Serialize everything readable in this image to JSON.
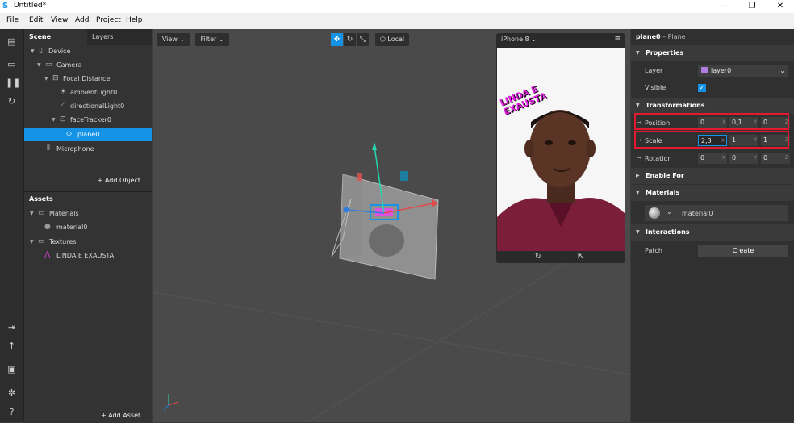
{
  "window": {
    "title": "Untitled*"
  },
  "menu": [
    "File",
    "Edit",
    "View",
    "Add",
    "Project",
    "Help"
  ],
  "scene": {
    "tabs": [
      "Scene",
      "Layers"
    ],
    "tree": [
      {
        "label": "Device",
        "depth": 0,
        "expand": "▼",
        "icon": "▯"
      },
      {
        "label": "Camera",
        "depth": 1,
        "expand": "▼",
        "icon": "▭"
      },
      {
        "label": "Focal Distance",
        "depth": 2,
        "expand": "▼",
        "icon": "⊟"
      },
      {
        "label": "ambientLight0",
        "depth": 3,
        "expand": "",
        "icon": "☀"
      },
      {
        "label": "directionalLight0",
        "depth": 3,
        "expand": "",
        "icon": "⟋"
      },
      {
        "label": "faceTracker0",
        "depth": 3,
        "expand": "▼",
        "icon": "⊡"
      },
      {
        "label": "plane0",
        "depth": 4,
        "expand": "",
        "icon": "◇",
        "selected": true
      },
      {
        "label": "Microphone",
        "depth": 1,
        "expand": "",
        "icon": "⦀"
      }
    ],
    "add_object": "Add Object"
  },
  "assets": {
    "title": "Assets",
    "items": [
      {
        "label": "Materials",
        "depth": 0,
        "expand": "▼",
        "icon": "▭"
      },
      {
        "label": "material0",
        "depth": 1,
        "expand": "",
        "icon": "●"
      },
      {
        "label": "Textures",
        "depth": 0,
        "expand": "▼",
        "icon": "▭"
      },
      {
        "label": "LINDA E EXAUSTA",
        "depth": 1,
        "expand": "",
        "icon": "⋀"
      }
    ],
    "add_asset": "Add Asset"
  },
  "viewport": {
    "view_label": "View",
    "filter_label": "Filter",
    "local_label": "Local",
    "sticker_text": "LINDA E EXAUSTA"
  },
  "simulator": {
    "device": "iPhone 8",
    "sticker_line1": "LINDA E",
    "sticker_line2": "EXAUSTA"
  },
  "properties": {
    "object_name": "plane0",
    "object_type": "– Plane",
    "sections": {
      "properties": "Properties",
      "transformations": "Transformations",
      "enable_for": "Enable For",
      "materials": "Materials",
      "interactions": "Interactions"
    },
    "layer_label": "Layer",
    "layer_value": "layer0",
    "layer_color": "#b07ee0",
    "visible_label": "Visible",
    "position_label": "Position",
    "position": {
      "x": "0",
      "y": "0,1",
      "z": "0"
    },
    "scale_label": "Scale",
    "scale": {
      "x": "2,3",
      "y": "1",
      "z": "1"
    },
    "rotation_label": "Rotation",
    "rotation": {
      "x": "0",
      "y": "0",
      "z": "0"
    },
    "material_value": "material0",
    "patch_label": "Patch",
    "create_label": "Create",
    "axis": {
      "x": "X",
      "y": "Y",
      "z": "Z"
    }
  },
  "colors": {
    "accent": "#1593e6",
    "highlight": "#e2192f",
    "sticker": "#e020e0"
  }
}
